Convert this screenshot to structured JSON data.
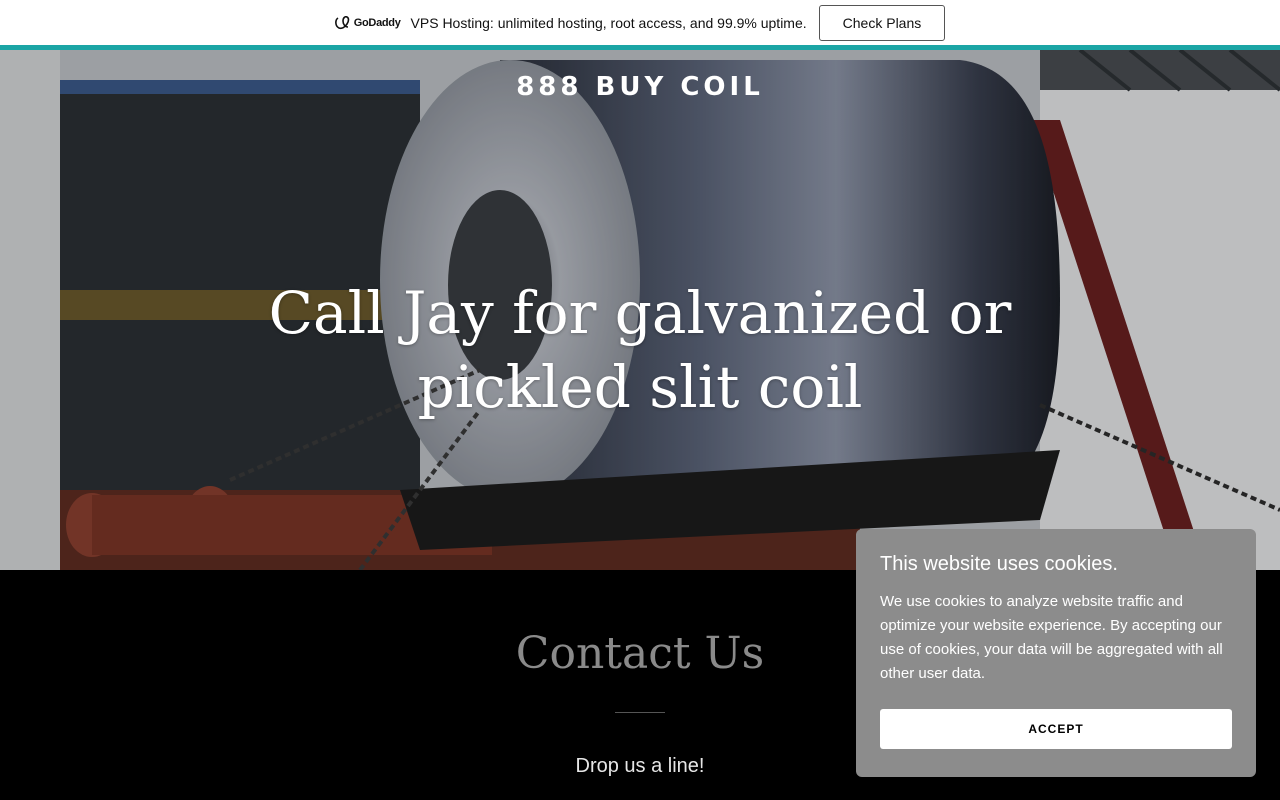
{
  "promo": {
    "logo_text": "GoDaddy",
    "text": "VPS Hosting: unlimited hosting, root access, and 99.9% uptime.",
    "button_label": "Check Plans",
    "accent_color": "#1ba5a5"
  },
  "hero": {
    "brand": "888 BUY COIL",
    "title_line1": "Call Jay for galvanized or",
    "title_line2": "pickled slit coil",
    "image": "steel-coil-photo"
  },
  "contact": {
    "title": "Contact Us",
    "subtitle": "Drop us a line!"
  },
  "cookie_banner": {
    "title": "This website uses cookies.",
    "body": "We use cookies to analyze website traffic and optimize your website experience. By accepting our use of cookies, your data will be aggregated with all other user data.",
    "accept_label": "ACCEPT"
  }
}
